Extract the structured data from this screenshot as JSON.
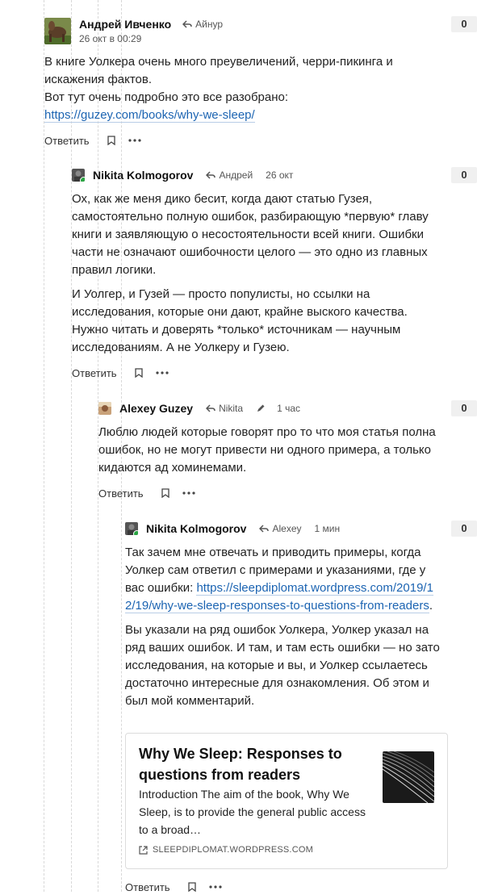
{
  "comments": [
    {
      "author": "Андрей Ивченко",
      "reply_to": "Айнур",
      "time": "26 окт в 00:29",
      "score": "0",
      "text": {
        "p1_a": "В книге Уолкера очень много преувеличений, черри-пикинга и искажения фактов.",
        "p1_b": "Вот тут очень подробно это все разобрано: ",
        "link": "https://guzey.com/books/why-we-sleep/"
      },
      "reply_label": "Ответить"
    },
    {
      "author": "Nikita Kolmogorov",
      "reply_to": "Андрей",
      "time": "26 окт",
      "score": "0",
      "text": {
        "p1": "Ох, как же меня дико бесит, когда дают статью Гузея, самостоятельно полную ошибок, разбирающую *первую* главу книги и заявляющую о несостоятельности всей книги. Ошибки части не означают ошибочности целого — это одно из главных правил логики.",
        "p2": "И Уолгер, и Гузей — просто популисты, но ссылки на исследования, которые они дают, крайне выского качества. Нужно читать и доверять *только* источникам — научным исследованиям. А не Уолкеру и Гузею."
      },
      "reply_label": "Ответить"
    },
    {
      "author": "Alexey Guzey",
      "reply_to": "Nikita",
      "time": "1 час",
      "score": "0",
      "text": {
        "p1": "Люблю людей которые говорят про то что моя статья полна ошибок, но не могут привести ни одного примера, а только кидаются ад хоминемами."
      },
      "reply_label": "Ответить"
    },
    {
      "author": "Nikita Kolmogorov",
      "reply_to": "Alexey",
      "time": "1 мин",
      "score": "0",
      "text": {
        "p1_a": "Так зачем мне отвечать и приводить примеры, когда Уолкер сам ответил с примерами и указаниями, где у вас ошибки: ",
        "link": "https://sleepdiplomat.wordpress.com/2019/12/19/why-we-sleep-responses-to-questions-from-readers",
        "p1_end": ".",
        "p2": "Вы указали на ряд ошибок Уолкера, Уолкер указал на ряд ваших ошибок. И там, и там есть ошибки — но зато исследования, на которые и вы, и Уолкер ссылаетесь достаточно интересные для ознакомления. Об этом и был мой комментарий."
      },
      "card": {
        "title": "Why We Sleep: Responses to questions from readers",
        "description": "Introduction The aim of the book, Why We Sleep, is to provide the general public access to a broad…",
        "domain": "SLEEPDIPLOMAT.WORDPRESS.COM"
      },
      "reply_label": "Ответить"
    }
  ],
  "icons": [
    "reply-arrow-icon",
    "bookmark-icon",
    "more-icon",
    "edit-pencil-icon",
    "external-link-icon"
  ],
  "colors": {
    "link": "#1c64b2",
    "online": "#2aa543",
    "score_bg": "#f0f0f0"
  }
}
